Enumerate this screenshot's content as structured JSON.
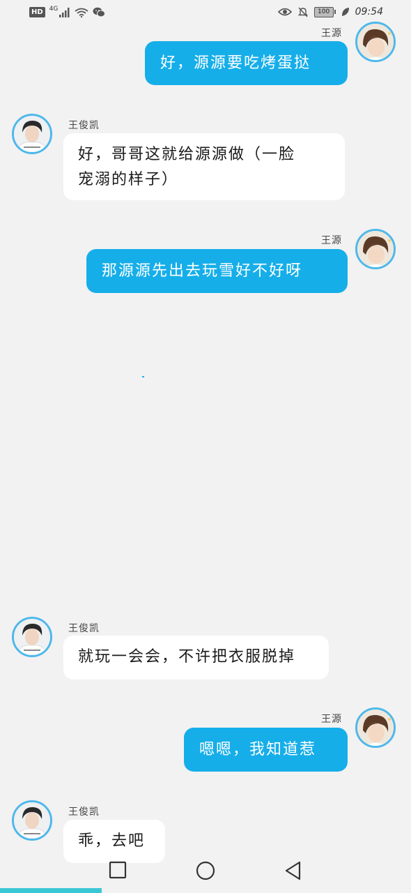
{
  "status_bar": {
    "hd": "HD",
    "network": "4G",
    "battery": "100",
    "time": "09:54"
  },
  "messages": [
    {
      "side": "right",
      "sender": "王源",
      "text": "好，源源要吃烤蛋挞"
    },
    {
      "side": "left",
      "sender": "王俊凯",
      "text_lines": [
        "好，哥哥这就给源源做（一脸",
        "宠溺的样子）"
      ]
    },
    {
      "side": "right",
      "sender": "王源",
      "text": "那源源先出去玩雪好不好呀"
    },
    {
      "side": "left",
      "sender": "王俊凯",
      "text": "就玩一会会，不许把衣服脱掉"
    },
    {
      "side": "right",
      "sender": "王源",
      "text": "嗯嗯，我知道惹"
    },
    {
      "side": "left",
      "sender": "王俊凯",
      "text": "乖，去吧"
    }
  ],
  "nav": {
    "icons": [
      "recent-apps-icon",
      "home-icon",
      "back-icon"
    ]
  },
  "colors": {
    "bubble_right": "#16aee9",
    "bubble_left": "#ffffff",
    "avatar_ring": "#4db8ec",
    "background": "#f2f2f2"
  }
}
